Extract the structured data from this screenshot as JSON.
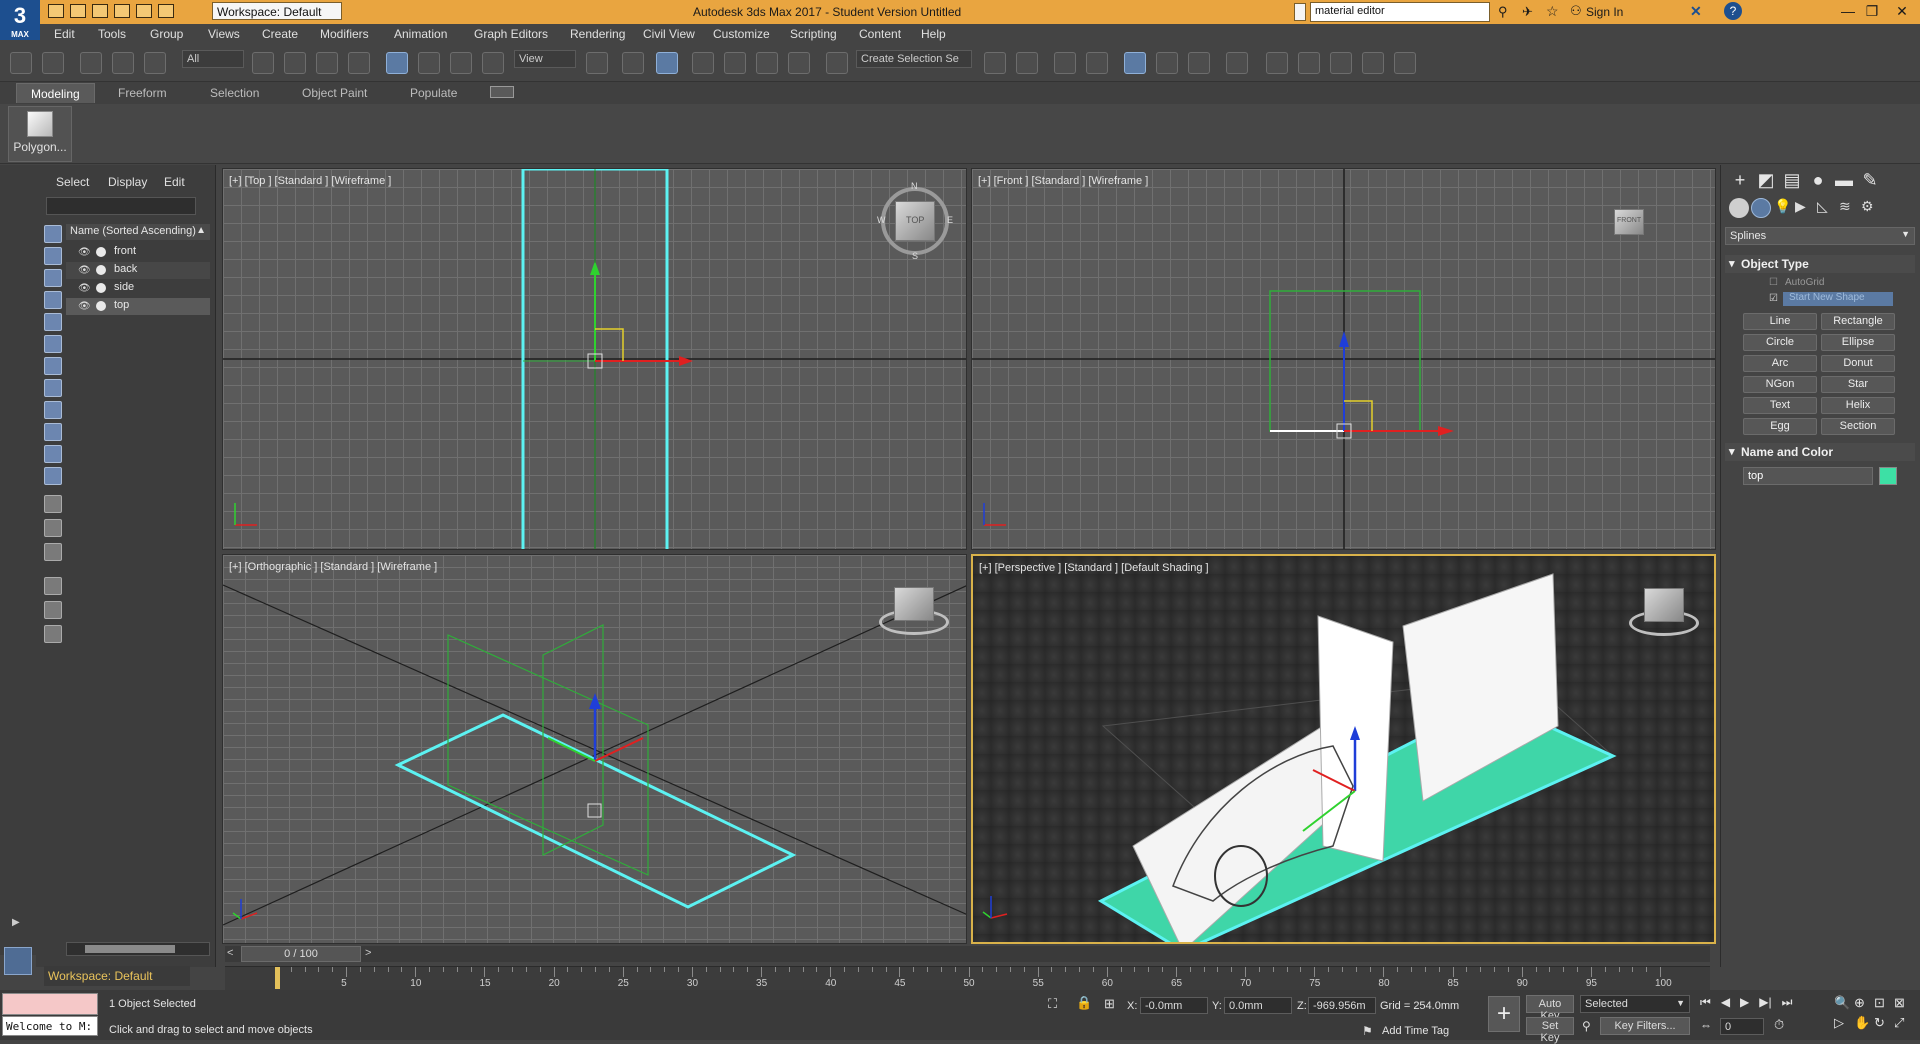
{
  "titlebar": {
    "title": "Autodesk 3ds Max 2017 - Student Version    Untitled",
    "workspace": "Workspace: Default",
    "search_value": "material editor",
    "signin": "Sign In",
    "logo": "3",
    "logo_sub": "MAX"
  },
  "menubar": {
    "items": [
      "Edit",
      "Tools",
      "Group",
      "Views",
      "Create",
      "Modifiers",
      "Animation",
      "Graph Editors",
      "Rendering",
      "Civil View",
      "Customize",
      "Scripting",
      "Content",
      "Help"
    ]
  },
  "toolbar": {
    "filter": "All",
    "ref_coord": "View",
    "selection_set": "Create Selection Se"
  },
  "ribbon": {
    "tabs": [
      "Modeling",
      "Freeform",
      "Selection",
      "Object Paint",
      "Populate"
    ],
    "polygon_label": "Polygon..."
  },
  "scene_explorer": {
    "tabs": [
      "Select",
      "Display",
      "Edit"
    ],
    "column_header": "Name (Sorted Ascending)",
    "objects": [
      "front",
      "back",
      "side",
      "top"
    ],
    "selected": "top"
  },
  "viewports": {
    "top": "[+] [Top ] [Standard ] [Wireframe ]",
    "front": "[+] [Front ] [Standard ] [Wireframe ]",
    "ortho": "[+] [Orthographic ] [Standard ] [Wireframe ]",
    "persp": "[+] [Perspective ] [Standard ] [Default Shading ]",
    "compass": {
      "n": "N",
      "s": "S",
      "e": "E",
      "w": "W",
      "center": "TOP"
    },
    "front_cube": "FRONT"
  },
  "command_panel": {
    "category": "Splines",
    "object_type_title": "Object Type",
    "autogrid": "AutoGrid",
    "start_new_shape": "Start New Shape",
    "buttons": [
      "Line",
      "Rectangle",
      "Circle",
      "Ellipse",
      "Arc",
      "Donut",
      "NGon",
      "Star",
      "Text",
      "Helix",
      "Egg",
      "Section"
    ],
    "name_color_title": "Name and Color",
    "object_name": "top",
    "object_color": "#3de0a5"
  },
  "timeline": {
    "frame_display": "0 / 100",
    "ticks": [
      5,
      10,
      15,
      20,
      25,
      30,
      35,
      40,
      45,
      50,
      55,
      60,
      65,
      70,
      75,
      80,
      85,
      90,
      95,
      100
    ],
    "current_frame": 0
  },
  "status": {
    "workspace": "Workspace: Default",
    "welcome": "Welcome to M:",
    "selected_count": "1 Object Selected",
    "prompt": "Click and drag to select and move objects",
    "x_label": "X:",
    "x_value": "-0.0mm",
    "y_label": "Y:",
    "y_value": "0.0mm",
    "z_label": "Z:",
    "z_value": "-969.956m",
    "grid": "Grid = 254.0mm",
    "add_time_tag": "Add Time Tag",
    "auto_key": "Auto Key",
    "set_key": "Set Key",
    "key_mode": "Selected",
    "key_filters": "Key Filters...",
    "frame_field": "0"
  }
}
